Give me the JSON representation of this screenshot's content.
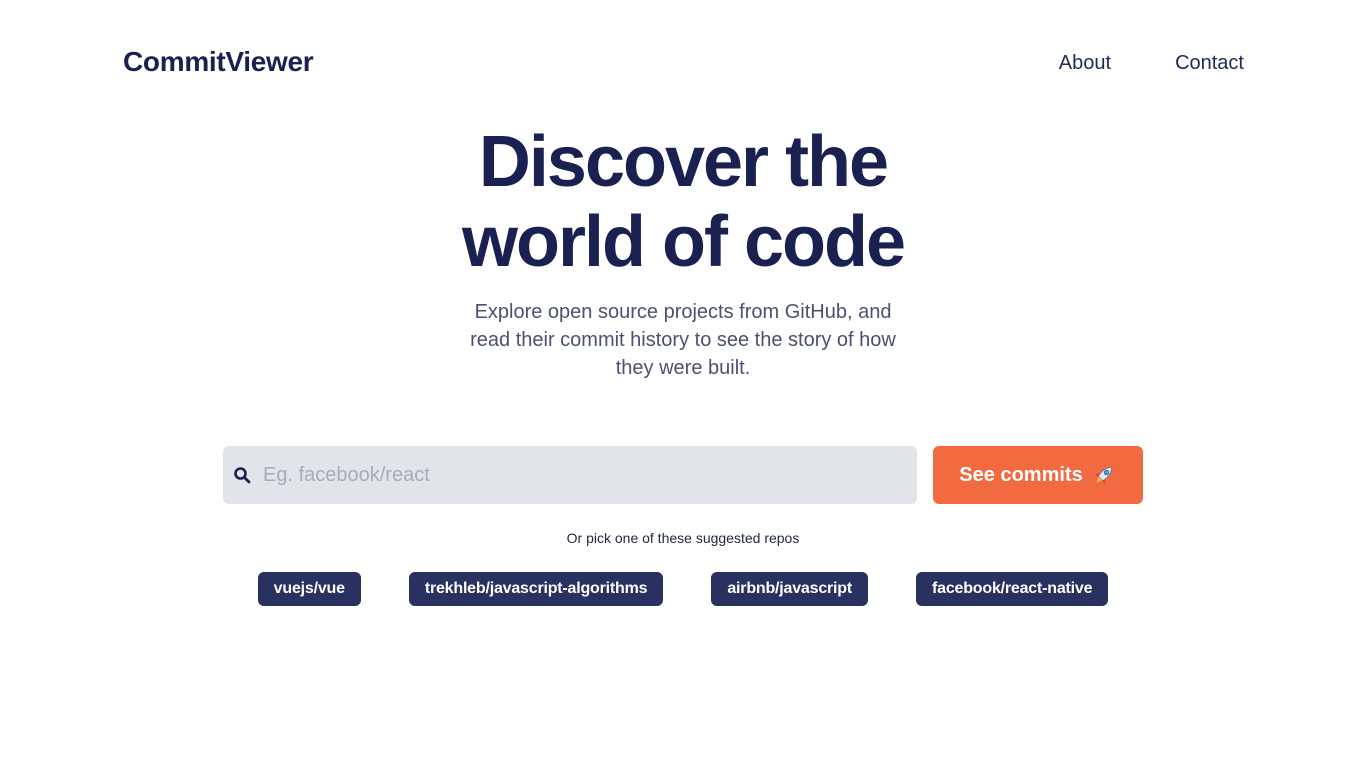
{
  "header": {
    "logo": "CommitViewer",
    "nav": [
      "About",
      "Contact"
    ]
  },
  "hero": {
    "title_line1": "Discover the",
    "title_line2": "world of code",
    "subtitle": "Explore open source projects from GitHub, and read their commit history to see the story of how they were built."
  },
  "search": {
    "placeholder": "Eg. facebook/react",
    "value": "",
    "icon": "search-icon",
    "button_label": "See commits",
    "button_icon": "rocket-icon"
  },
  "suggestions": {
    "label": "Or pick one of these suggested repos",
    "repos": [
      "vuejs/vue",
      "trekhleb/javascript-algorithms",
      "airbnb/javascript",
      "facebook/react-native"
    ]
  },
  "colors": {
    "primary_text": "#1a2150",
    "accent": "#f26a3f",
    "chip_bg": "#283160",
    "input_bg": "#e1e5ea"
  }
}
